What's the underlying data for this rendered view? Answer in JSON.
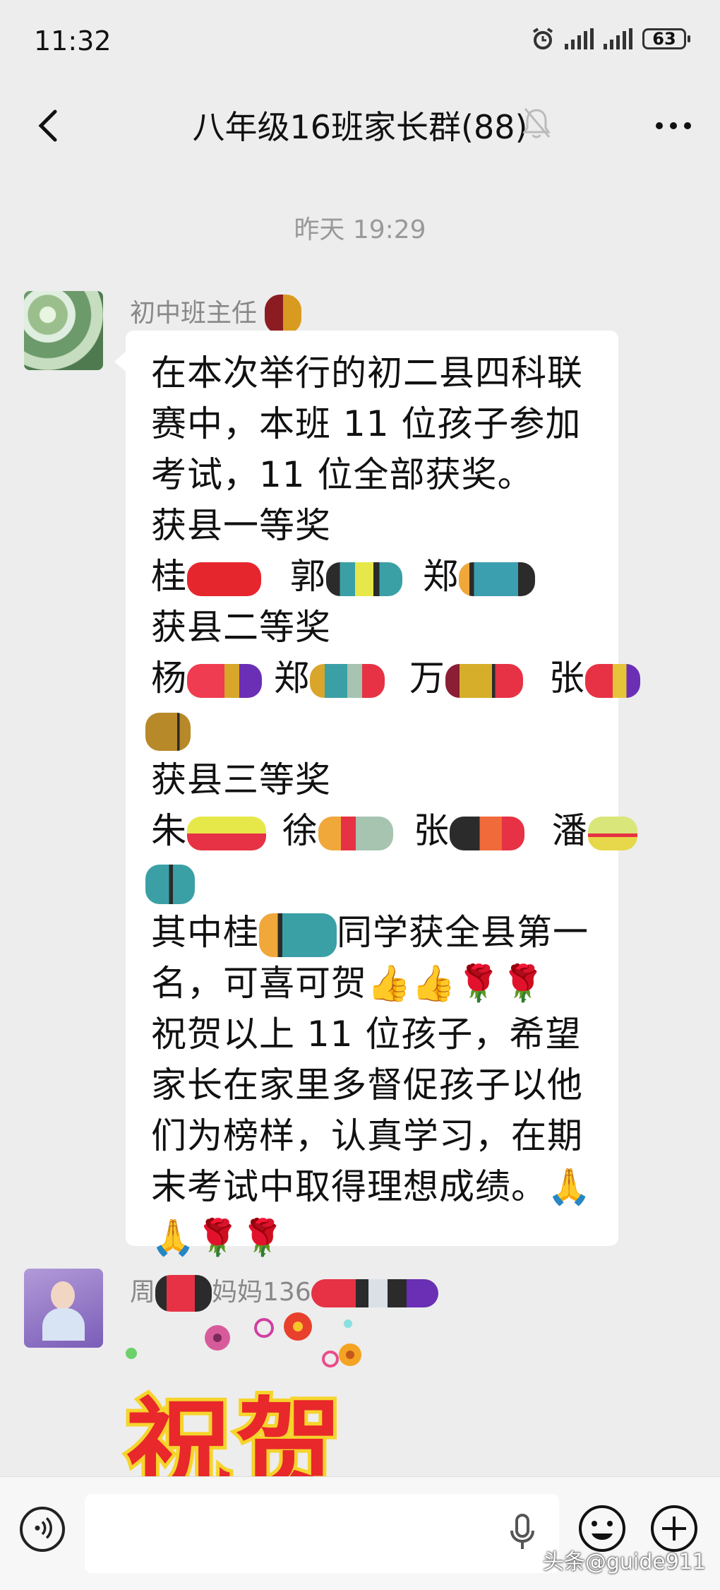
{
  "status_bar": {
    "time": "11:32",
    "battery": "63"
  },
  "header": {
    "title": "八年级16班家长群(88)"
  },
  "chat": {
    "timestamp": "昨天 19:29",
    "message1": {
      "sender": "初中班主任",
      "lines": [
        "在本次举行的初二县四科联",
        "赛中，本班 11 位孩子参加",
        "考试，11 位全部获奖。",
        "获县一等奖",
        "桂",
        "郭",
        "郑",
        "获县二等奖",
        "杨",
        "郑",
        "万",
        "张",
        "获县三等奖",
        "朱",
        "徐",
        "张",
        "潘",
        "其中桂",
        "同学获全县第一",
        "名，可喜可贺👍👍🌹🌹",
        "祝贺以上 11 位孩子，希望",
        "家长在家里多督促孩子以他",
        "们为榜样，认真学习，在期",
        "末考试中取得理想成绩。🙏",
        "🙏🌹🌹"
      ]
    },
    "message2": {
      "sender_a": "周",
      "sender_b": "妈妈136",
      "sticker_text": "祝贺"
    }
  },
  "watermark": "头条@guide911",
  "icons": {
    "back": "chevron-left-icon",
    "mute": "bell-off-icon",
    "more": "more-dots-icon",
    "voice": "voice-icon",
    "mic": "mic-icon",
    "emoji": "emoji-icon",
    "plus": "plus-icon"
  }
}
